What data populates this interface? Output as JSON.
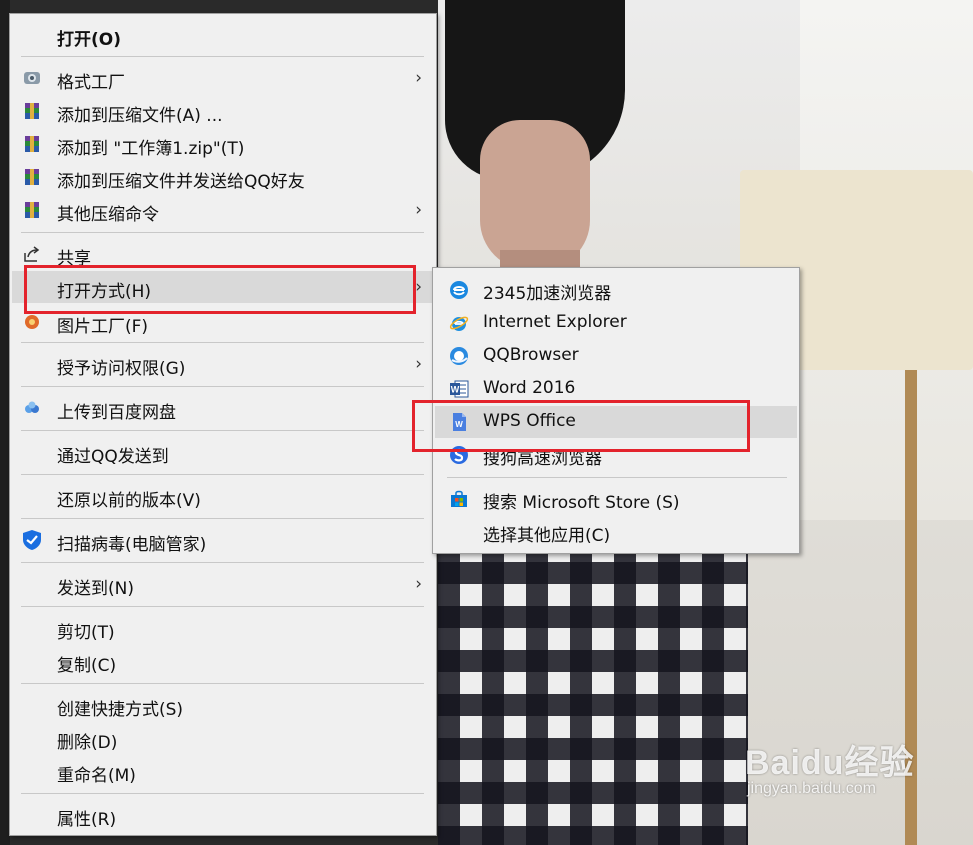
{
  "context_menu": {
    "items": [
      {
        "label": "打开(O)",
        "icon": "none"
      },
      {
        "label": "格式工厂",
        "icon": "format-factory-icon"
      },
      {
        "label": "添加到压缩文件(A) ...",
        "icon": "winrar-icon"
      },
      {
        "label": "添加到 \"工作簿1.zip\"(T)",
        "icon": "winrar-icon"
      },
      {
        "label": "添加到压缩文件并发送给QQ好友",
        "icon": "winrar-icon"
      },
      {
        "label": "其他压缩命令",
        "icon": "winrar-icon"
      },
      {
        "label": "共享",
        "icon": "share-icon"
      },
      {
        "label": "打开方式(H)",
        "icon": "none"
      },
      {
        "label": "图片工厂(F)",
        "icon": "picture-factory-icon"
      },
      {
        "label": "授予访问权限(G)",
        "icon": "none"
      },
      {
        "label": "上传到百度网盘",
        "icon": "baidu-netdisk-icon"
      },
      {
        "label": "通过QQ发送到",
        "icon": "none"
      },
      {
        "label": "还原以前的版本(V)",
        "icon": "none"
      },
      {
        "label": "扫描病毒(电脑管家)",
        "icon": "tencent-pc-manager-icon"
      },
      {
        "label": "发送到(N)",
        "icon": "none"
      },
      {
        "label": "剪切(T)",
        "icon": "none"
      },
      {
        "label": "复制(C)",
        "icon": "none"
      },
      {
        "label": "创建快捷方式(S)",
        "icon": "none"
      },
      {
        "label": "删除(D)",
        "icon": "none"
      },
      {
        "label": "重命名(M)",
        "icon": "none"
      },
      {
        "label": "属性(R)",
        "icon": "none"
      }
    ],
    "submenu_arrow": "›"
  },
  "open_with_submenu": {
    "items": [
      {
        "label": "2345加速浏览器",
        "icon": "browser-2345-icon"
      },
      {
        "label": "Internet Explorer",
        "icon": "internet-explorer-icon"
      },
      {
        "label": "QQBrowser",
        "icon": "qqbrowser-icon"
      },
      {
        "label": "Word 2016",
        "icon": "word-icon"
      },
      {
        "label": "WPS Office",
        "icon": "wps-office-icon"
      },
      {
        "label": "搜狗高速浏览器",
        "icon": "sogou-browser-icon"
      },
      {
        "label": "搜索 Microsoft Store (S)",
        "icon": "microsoft-store-icon"
      },
      {
        "label": "选择其他应用(C)",
        "icon": "none"
      }
    ]
  },
  "watermark": {
    "brand": "Baidu经验",
    "url": "jingyan.baidu.com"
  },
  "colors": {
    "highlight_box": "#e3232c",
    "menu_background": "#f0f0f0",
    "hover_background": "#d9d9d9"
  }
}
